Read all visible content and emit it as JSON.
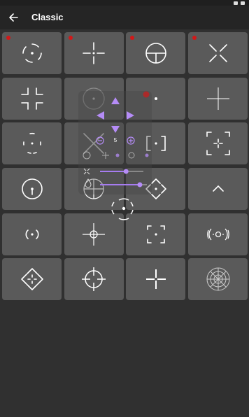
{
  "app_bar": {
    "title": "Classic",
    "back_icon": "arrow-left-icon"
  },
  "colors": {
    "tile": "#5a5a5a",
    "background": "#303030",
    "accent": "#a67cf0",
    "badge": "#d21818"
  },
  "crosshairs": [
    {
      "name": "crosshair-1",
      "icon": "dotted-circle-crosshair",
      "badge": true
    },
    {
      "name": "crosshair-2",
      "icon": "gap-cross-dot-crosshair",
      "badge": true
    },
    {
      "name": "crosshair-3",
      "icon": "scope-circle-crosshair",
      "badge": true
    },
    {
      "name": "crosshair-4",
      "icon": "x-crosshair",
      "badge": true
    },
    {
      "name": "crosshair-5",
      "icon": "corner-brackets-cross-crosshair",
      "badge": false
    },
    {
      "name": "crosshair-6",
      "icon": "dot-circle-crosshair",
      "badge": false
    },
    {
      "name": "crosshair-7",
      "icon": "red-dot-crosshair",
      "badge": false
    },
    {
      "name": "crosshair-8",
      "icon": "thin-cross-crosshair",
      "badge": false
    },
    {
      "name": "crosshair-9",
      "icon": "arc-dot-crosshair",
      "badge": false
    },
    {
      "name": "crosshair-10",
      "icon": "x-brackets-crosshair",
      "badge": false
    },
    {
      "name": "crosshair-11",
      "icon": "bracket-dot-crosshair",
      "badge": false
    },
    {
      "name": "crosshair-12",
      "icon": "corner-box-crosshair",
      "badge": false
    },
    {
      "name": "crosshair-13",
      "icon": "circle-tick-crosshair",
      "badge": false
    },
    {
      "name": "crosshair-14",
      "icon": "circle-cross-crosshair",
      "badge": false
    },
    {
      "name": "crosshair-15",
      "icon": "diamond-dot-crosshair",
      "badge": false
    },
    {
      "name": "crosshair-16",
      "icon": "chevron-crosshair",
      "badge": false
    },
    {
      "name": "crosshair-17",
      "icon": "paren-dot-crosshair",
      "badge": false
    },
    {
      "name": "crosshair-18",
      "icon": "cross-small-circle-crosshair",
      "badge": false
    },
    {
      "name": "crosshair-19",
      "icon": "corner-dot-crosshair",
      "badge": false
    },
    {
      "name": "crosshair-20",
      "icon": "arrows-circle-crosshair",
      "badge": false
    },
    {
      "name": "crosshair-21",
      "icon": "diamond-corners-crosshair",
      "badge": false
    },
    {
      "name": "crosshair-22",
      "icon": "scope-cross-crosshair",
      "badge": false
    },
    {
      "name": "crosshair-23",
      "icon": "plus-gap-crosshair",
      "badge": false
    },
    {
      "name": "crosshair-24",
      "icon": "target-circle-crosshair",
      "badge": false
    }
  ],
  "overlay": {
    "size_value": "5",
    "scale_slider_level": 0.6,
    "opacity_slider_level": 0.85,
    "decrease_icon": "minus-circle-icon",
    "increase_icon": "plus-circle-icon",
    "move_icons": [
      "arrow-up-icon",
      "arrow-left-icon",
      "arrow-right-icon",
      "arrow-down-icon"
    ],
    "scale_icon": "expand-icon",
    "opacity_icon": "drop-icon"
  }
}
